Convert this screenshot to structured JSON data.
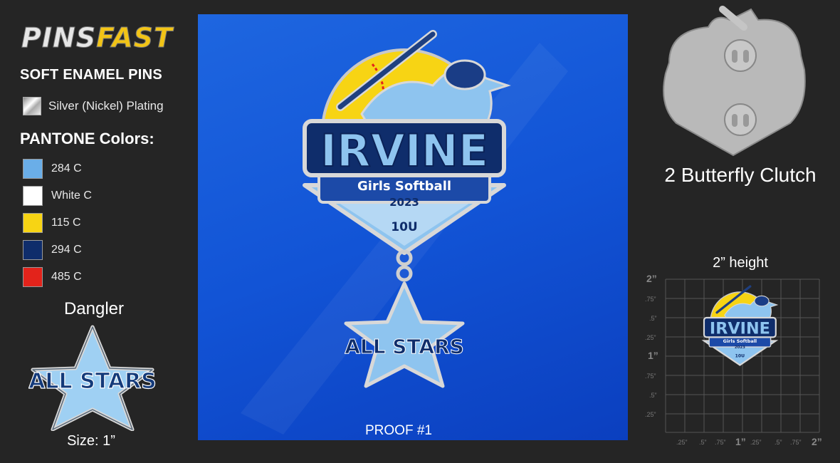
{
  "logo": {
    "part1": "PINS",
    "part2": "FAST"
  },
  "left": {
    "heading": "SOFT ENAMEL PINS",
    "plating_label": "Silver (Nickel) Plating",
    "pantone_title": "PANTONE Colors:",
    "pantone_colors": [
      {
        "label": "284 C",
        "color": "#6aaee8"
      },
      {
        "label": "White C",
        "color": "#ffffff"
      },
      {
        "label": "115 C",
        "color": "#f7d414"
      },
      {
        "label": "294 C",
        "color": "#0f2d6b"
      },
      {
        "label": "485 C",
        "color": "#e3231b"
      }
    ],
    "dangler_title": "Dangler",
    "dangler_text": "ALL STARS",
    "size_label": "Size: 1”"
  },
  "pin": {
    "name": "IRVINE",
    "subtitle": "Girls Softball",
    "year": "2023",
    "division": "10U",
    "dangler_text": "ALL STARS"
  },
  "proof_label": "PROOF #1",
  "right": {
    "clutch_label": "2 Butterfly Clutch",
    "height_label": "2” height",
    "y_ticks": [
      "2”",
      ".75”",
      ".5”",
      ".25”",
      "1”",
      ".75”",
      ".5”",
      ".25”"
    ],
    "x_ticks": [
      ".25”",
      ".5”",
      ".75”",
      "1”",
      ".25”",
      ".5”",
      ".75”",
      "2”"
    ]
  },
  "colors": {
    "background": "#252525",
    "proof_blue": "#1254d6",
    "light_blue": "#8ec4ef",
    "navy": "#0f2d6b",
    "yellow": "#f7d414",
    "red": "#e3231b",
    "silver": "#bdbdbd"
  }
}
